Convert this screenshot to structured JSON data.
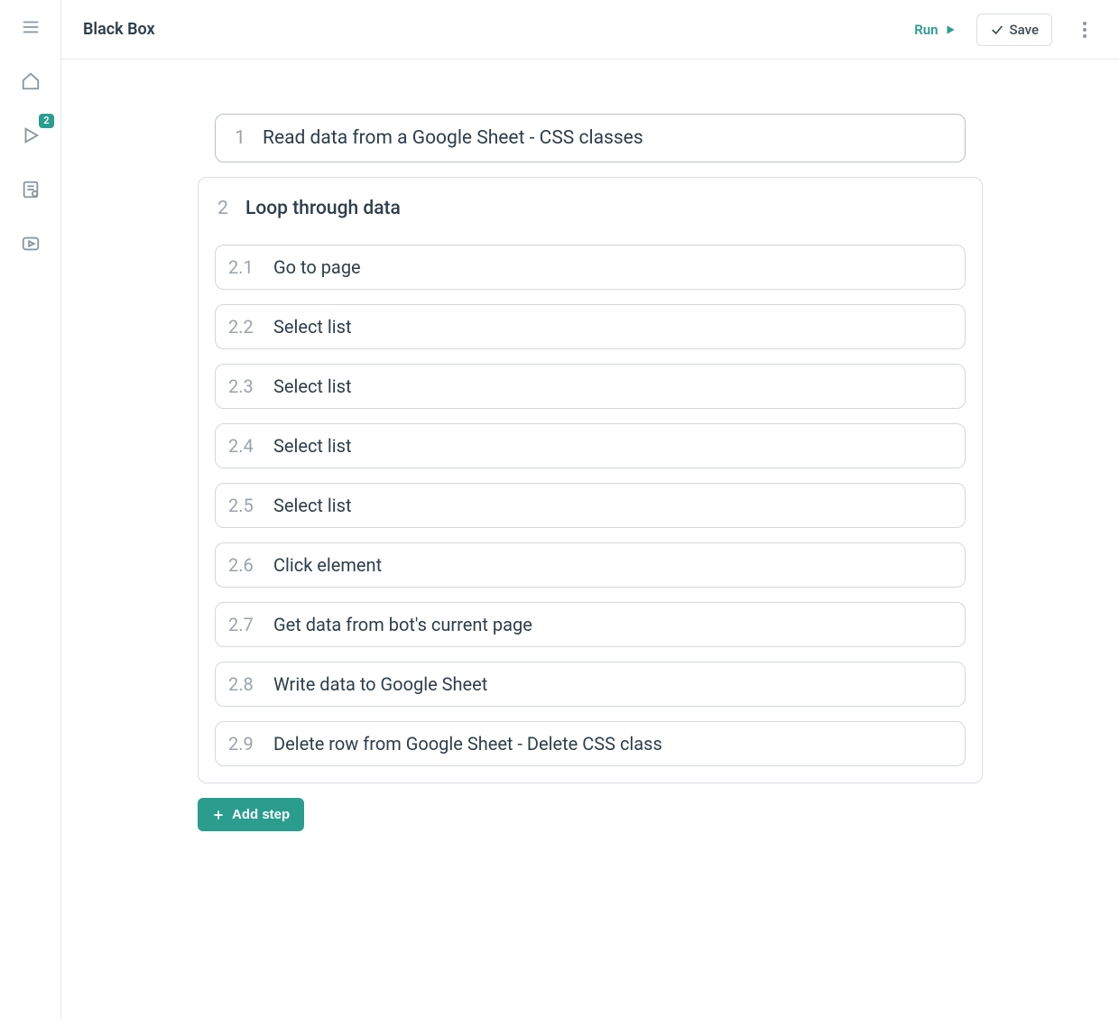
{
  "header": {
    "title": "Black Box",
    "run_label": "Run",
    "save_label": "Save"
  },
  "sidebar": {
    "badge_count": "2"
  },
  "steps": {
    "s1": {
      "num": "1",
      "label": "Read data from a Google Sheet - CSS classes"
    },
    "s2": {
      "num": "2",
      "label": "Loop through data"
    }
  },
  "substeps": {
    "s21": {
      "num": "2.1",
      "label": "Go to page"
    },
    "s22": {
      "num": "2.2",
      "label": "Select list"
    },
    "s23": {
      "num": "2.3",
      "label": "Select list"
    },
    "s24": {
      "num": "2.4",
      "label": "Select list"
    },
    "s25": {
      "num": "2.5",
      "label": "Select list"
    },
    "s26": {
      "num": "2.6",
      "label": "Click element"
    },
    "s27": {
      "num": "2.7",
      "label": "Get data from bot's current page"
    },
    "s28": {
      "num": "2.8",
      "label": "Write data to Google Sheet"
    },
    "s29": {
      "num": "2.9",
      "label": "Delete row from Google Sheet - Delete CSS class"
    }
  },
  "buttons": {
    "add_step": "Add step"
  }
}
